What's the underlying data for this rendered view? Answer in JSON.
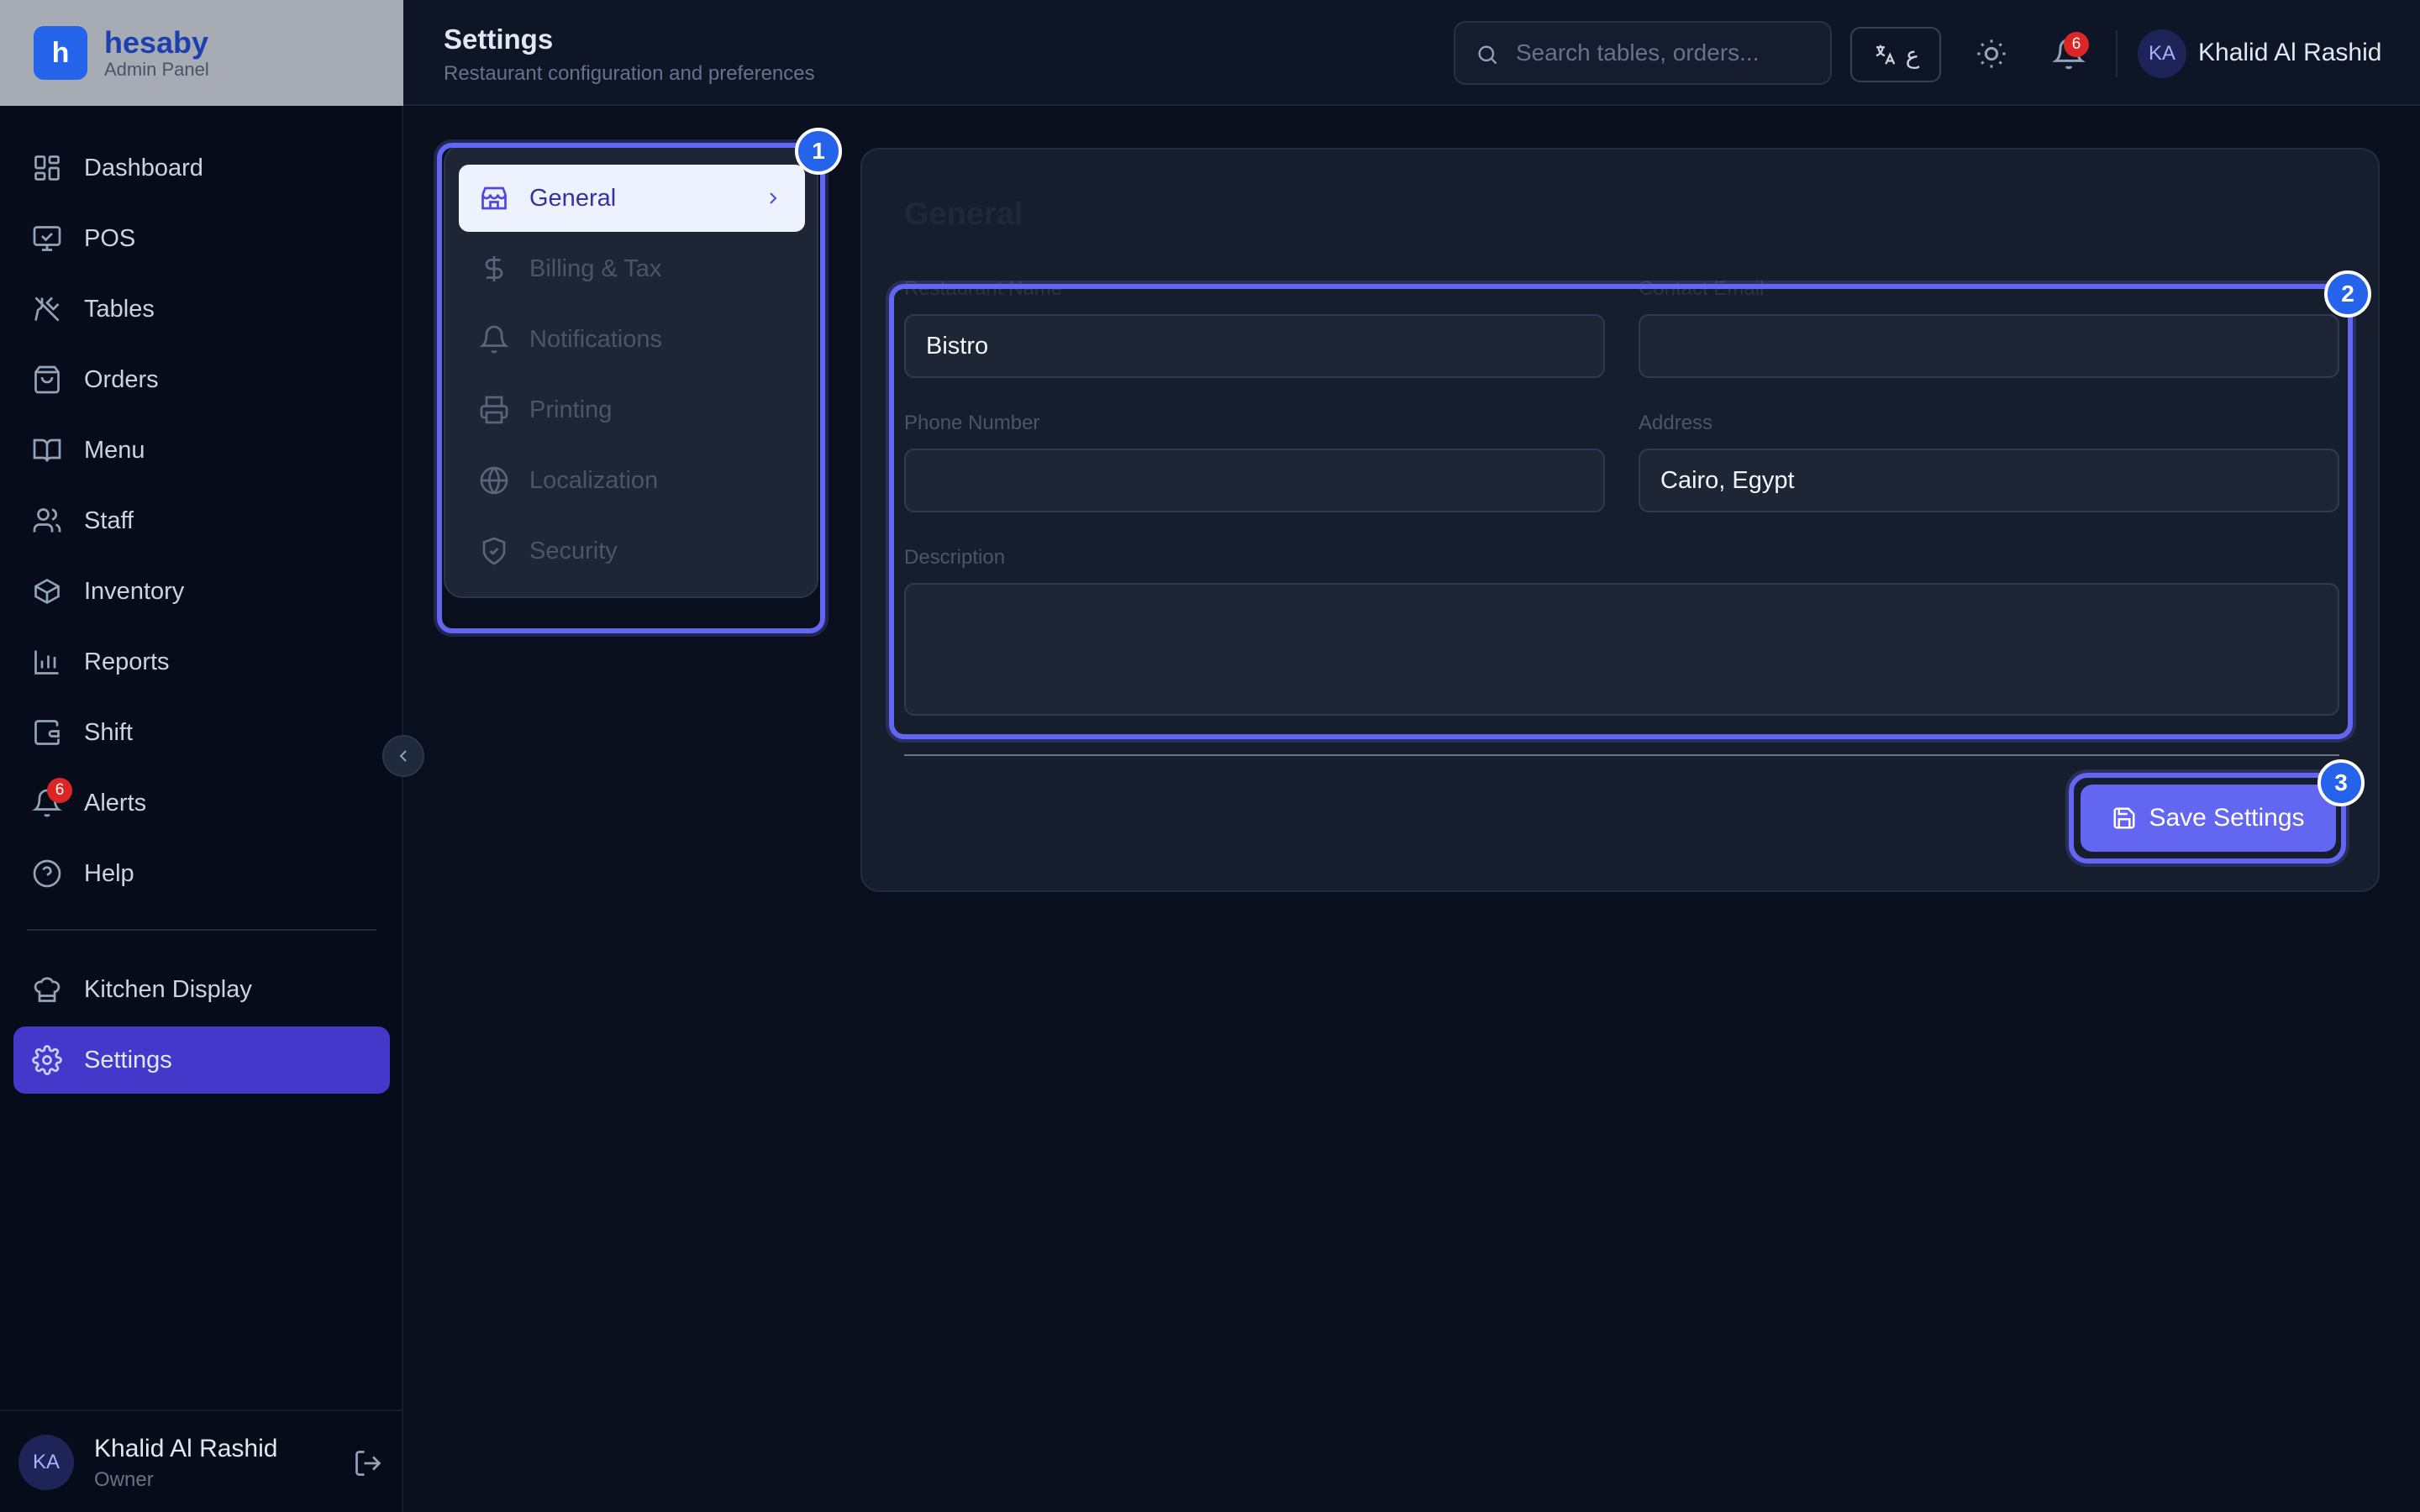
{
  "brand": {
    "logo_letter": "h",
    "name": "hesaby",
    "subtitle": "Admin Panel"
  },
  "sidebar": {
    "items": [
      {
        "label": "Dashboard",
        "icon": "grid-icon"
      },
      {
        "label": "POS",
        "icon": "monitor-icon"
      },
      {
        "label": "Tables",
        "icon": "utensils-icon"
      },
      {
        "label": "Orders",
        "icon": "shopping-bag-icon"
      },
      {
        "label": "Menu",
        "icon": "book-open-icon"
      },
      {
        "label": "Staff",
        "icon": "users-icon"
      },
      {
        "label": "Inventory",
        "icon": "box-icon"
      },
      {
        "label": "Reports",
        "icon": "bar-chart-icon"
      },
      {
        "label": "Shift",
        "icon": "wallet-icon"
      },
      {
        "label": "Alerts",
        "icon": "bell-icon",
        "badge": "6"
      },
      {
        "label": "Help",
        "icon": "help-circle-icon"
      }
    ],
    "secondary_items": [
      {
        "label": "Kitchen Display",
        "icon": "chef-hat-icon"
      },
      {
        "label": "Settings",
        "icon": "gear-icon",
        "active": true
      }
    ],
    "user": {
      "initials": "KA",
      "name": "Khalid Al Rashid",
      "role": "Owner"
    }
  },
  "header": {
    "title": "Settings",
    "subtitle": "Restaurant configuration and preferences",
    "search_placeholder": "Search tables, orders...",
    "lang_label": "ع",
    "notification_count": "6",
    "user_initials": "KA",
    "user_name": "Khalid Al Rashid"
  },
  "settings_menu": {
    "items": [
      {
        "label": "General",
        "icon": "store-icon",
        "active": true
      },
      {
        "label": "Billing & Tax",
        "icon": "dollar-icon"
      },
      {
        "label": "Notifications",
        "icon": "bell-icon"
      },
      {
        "label": "Printing",
        "icon": "printer-icon"
      },
      {
        "label": "Localization",
        "icon": "globe-icon"
      },
      {
        "label": "Security",
        "icon": "shield-check-icon"
      }
    ]
  },
  "general": {
    "title": "General",
    "fields": {
      "restaurant_name": {
        "label": "Restaurant Name",
        "value": "Bistro"
      },
      "contact_email": {
        "label": "Contact Email",
        "value": ""
      },
      "phone_number": {
        "label": "Phone Number",
        "value": ""
      },
      "address": {
        "label": "Address",
        "value": "Cairo, Egypt"
      },
      "description": {
        "label": "Description",
        "value": ""
      }
    },
    "save_label": "Save Settings"
  },
  "tour": {
    "steps": [
      "1",
      "2",
      "3"
    ]
  },
  "colors": {
    "accent": "#6366f1",
    "active_nav": "#4338ca",
    "badge": "#dc2626",
    "step_badge": "#2563eb"
  }
}
